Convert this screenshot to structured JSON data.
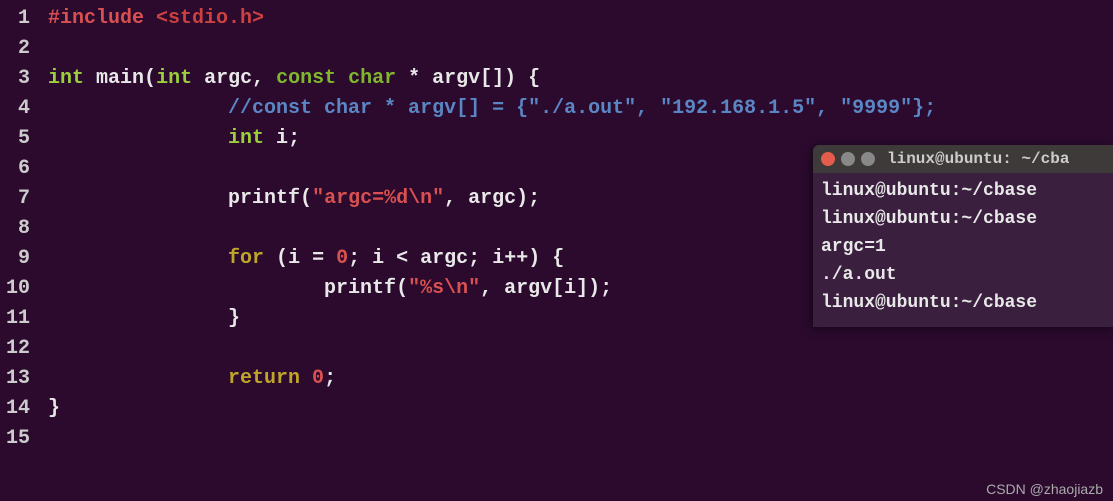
{
  "editor": {
    "lines": {
      "1": {
        "preproc": "#include",
        "include": " <stdio.h>"
      },
      "3": {
        "t1": "int ",
        "fn": "main",
        "op1": "(",
        "t2": "int ",
        "id1": "argc",
        "op2": ", ",
        "t3": "const char ",
        "op3": "* ",
        "id2": "argv",
        "op4": "[]) {"
      },
      "4": {
        "indent": "                ",
        "comment": "//const char * argv[] = {\"./a.out\", \"192.168.1.5\", \"9999\"};"
      },
      "5": {
        "indent": "                ",
        "t": "int ",
        "id": "i",
        "end": ";"
      },
      "7": {
        "indent": "                ",
        "fn": "printf",
        "op1": "(",
        "str": "\"argc=%d\\n\"",
        "op2": ", ",
        "id": "argc",
        "end": ");"
      },
      "9": {
        "indent": "                ",
        "kw": "for ",
        "op1": "(",
        "id1": "i",
        "op2": " = ",
        "num1": "0",
        "op3": "; ",
        "id2": "i",
        "op4": " < ",
        "id3": "argc",
        "op5": "; ",
        "id4": "i",
        "op6": "++) {"
      },
      "10": {
        "indent": "                        ",
        "fn": "printf",
        "op1": "(",
        "str": "\"%s\\n\"",
        "op2": ", ",
        "id": "argv",
        "op3": "[",
        "id2": "i",
        "end": "]);"
      },
      "11": {
        "indent": "                ",
        "brace": "}"
      },
      "13": {
        "indent": "                ",
        "kw": "return ",
        "num": "0",
        "end": ";"
      },
      "14": {
        "brace": " }"
      }
    }
  },
  "terminal": {
    "title": "linux@ubuntu: ~/cba",
    "lines": [
      "linux@ubuntu:~/cbase",
      "linux@ubuntu:~/cbase",
      "argc=1",
      "./a.out",
      "linux@ubuntu:~/cbase"
    ]
  },
  "watermark": "CSDN @zhaojiazb"
}
